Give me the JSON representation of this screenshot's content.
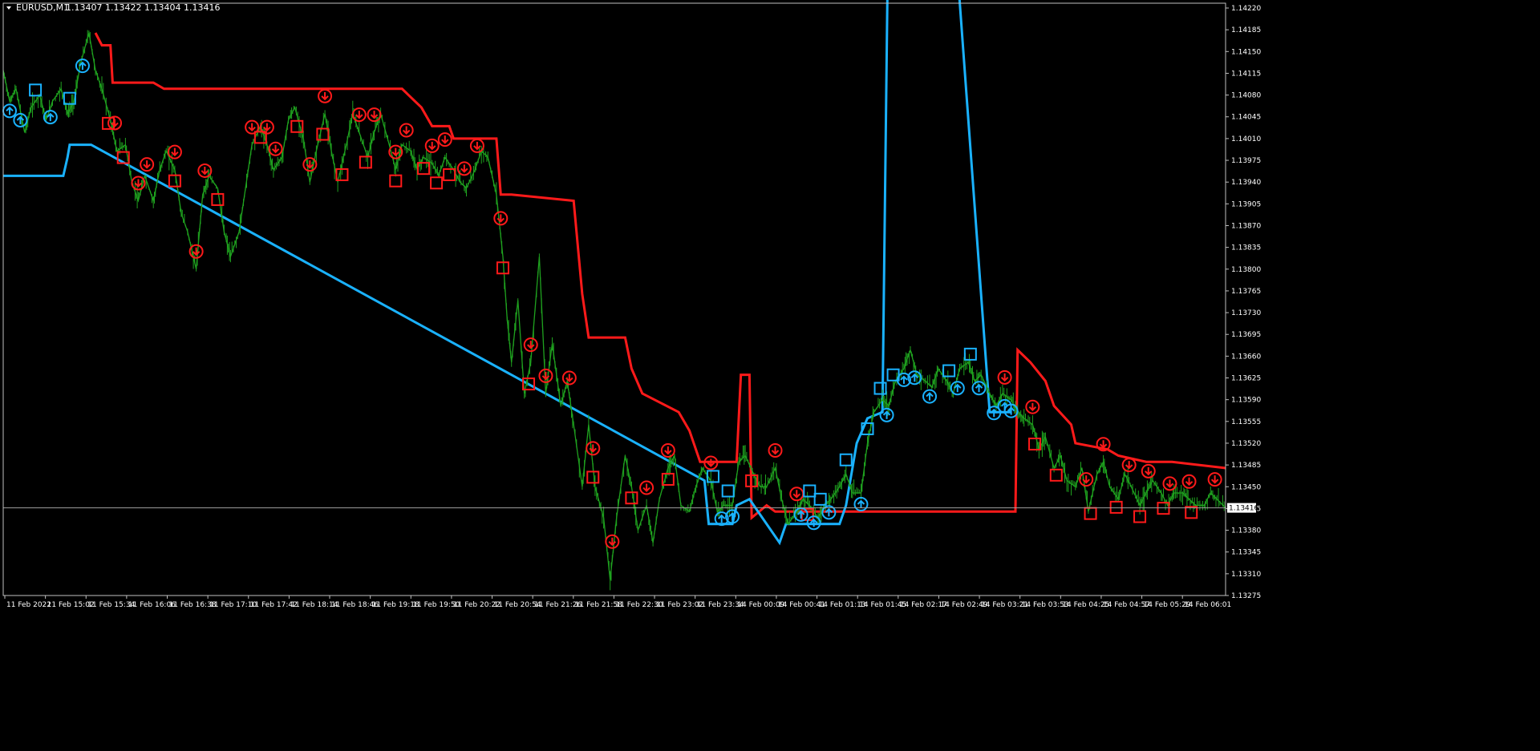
{
  "header": {
    "symbol": "EURUSD,M1",
    "quotes": "1.13407 1.13422 1.13404 1.13416"
  },
  "colors": {
    "background": "#000000",
    "frame": "#c0c0c0",
    "price": "#1fa21f",
    "upper_band": "#ff1a1a",
    "lower_band": "#1ab2ff",
    "sell_marker": "#ff1a1a",
    "buy_marker": "#1ab2ff",
    "current_price_line": "#9e9e9e",
    "price_tag_bg": "#ffffff"
  },
  "chart_data": {
    "type": "line",
    "ylim": [
      1.13275,
      1.1422
    ],
    "y_ticks": [
      "1.14220",
      "1.14185",
      "1.14150",
      "1.14115",
      "1.14080",
      "1.14045",
      "1.14010",
      "1.13975",
      "1.13940",
      "1.13905",
      "1.13870",
      "1.13835",
      "1.13800",
      "1.13765",
      "1.13730",
      "1.13695",
      "1.13660",
      "1.13625",
      "1.13590",
      "1.13555",
      "1.13520",
      "1.13485",
      "1.13450",
      "1.13415",
      "1.13380",
      "1.13345",
      "1.13310",
      "1.13275"
    ],
    "x_ticks": [
      "11 Feb 2022",
      "11 Feb 15:02",
      "11 Feb 15:34",
      "11 Feb 16:06",
      "11 Feb 16:38",
      "11 Feb 17:10",
      "11 Feb 17:42",
      "11 Feb 18:14",
      "11 Feb 18:46",
      "11 Feb 19:18",
      "11 Feb 19:50",
      "11 Feb 20:22",
      "11 Feb 20:54",
      "11 Feb 21:26",
      "11 Feb 21:58",
      "11 Feb 22:30",
      "11 Feb 23:02",
      "11 Feb 23:34",
      "14 Feb 00:09",
      "14 Feb 00:41",
      "14 Feb 01:13",
      "14 Feb 01:45",
      "14 Feb 02:17",
      "14 Feb 02:49",
      "14 Feb 03:21",
      "14 Feb 03:53",
      "14 Feb 04:25",
      "14 Feb 04:57",
      "14 Feb 05:29",
      "14 Feb 06:01"
    ],
    "current_price": 1.13416,
    "current_price_label": "1.13416",
    "series": [
      {
        "kind": "price",
        "points": [
          [
            0,
            1.1412
          ],
          [
            0.3,
            1.1407
          ],
          [
            0.6,
            1.1409
          ],
          [
            1,
            1.1402
          ],
          [
            1.3,
            1.1406
          ],
          [
            1.7,
            1.1408
          ],
          [
            2,
            1.1404
          ],
          [
            2.3,
            1.1407
          ],
          [
            2.7,
            1.1409
          ],
          [
            3,
            1.1405
          ],
          [
            3.3,
            1.1407
          ],
          [
            3.6,
            1.1413
          ],
          [
            4,
            1.1418
          ],
          [
            4.3,
            1.1412
          ],
          [
            4.6,
            1.1409
          ],
          [
            5,
            1.1404
          ],
          [
            5.3,
            1.1399
          ],
          [
            5.7,
            1.14
          ],
          [
            6,
            1.1394
          ],
          [
            6.3,
            1.1391
          ],
          [
            6.6,
            1.1395
          ],
          [
            7,
            1.1391
          ],
          [
            7.3,
            1.1396
          ],
          [
            7.6,
            1.1399
          ],
          [
            8,
            1.1396
          ],
          [
            8.3,
            1.1389
          ],
          [
            8.6,
            1.1386
          ],
          [
            9,
            1.138
          ],
          [
            9.3,
            1.1392
          ],
          [
            9.6,
            1.1395
          ],
          [
            10,
            1.1393
          ],
          [
            10.3,
            1.1386
          ],
          [
            10.6,
            1.1382
          ],
          [
            11,
            1.1386
          ],
          [
            11.3,
            1.1393
          ],
          [
            11.6,
            1.14
          ],
          [
            12,
            1.1403
          ],
          [
            12.3,
            1.14
          ],
          [
            12.6,
            1.1396
          ],
          [
            13,
            1.1398
          ],
          [
            13.3,
            1.1404
          ],
          [
            13.6,
            1.1406
          ],
          [
            14,
            1.1401
          ],
          [
            14.3,
            1.1394
          ],
          [
            14.6,
            1.1399
          ],
          [
            15,
            1.1405
          ],
          [
            15.3,
            1.1399
          ],
          [
            15.6,
            1.1394
          ],
          [
            16,
            1.14
          ],
          [
            16.3,
            1.1405
          ],
          [
            16.6,
            1.1402
          ],
          [
            17,
            1.1398
          ],
          [
            17.3,
            1.1402
          ],
          [
            17.6,
            1.1405
          ],
          [
            18,
            1.14
          ],
          [
            18.3,
            1.1396
          ],
          [
            18.6,
            1.14
          ],
          [
            19,
            1.1399
          ],
          [
            19.3,
            1.1396
          ],
          [
            19.6,
            1.1398
          ],
          [
            20,
            1.1397
          ],
          [
            20.3,
            1.1395
          ],
          [
            20.6,
            1.1398
          ],
          [
            21,
            1.1396
          ],
          [
            21.3,
            1.1394
          ],
          [
            21.6,
            1.1393
          ],
          [
            22,
            1.1396
          ],
          [
            22.3,
            1.1399
          ],
          [
            22.6,
            1.1398
          ],
          [
            23,
            1.1392
          ],
          [
            23.3,
            1.1382
          ],
          [
            23.5,
            1.1372
          ],
          [
            23.7,
            1.1365
          ],
          [
            24,
            1.1375
          ],
          [
            24.3,
            1.136
          ],
          [
            24.6,
            1.1365
          ],
          [
            25,
            1.1382
          ],
          [
            25.3,
            1.136
          ],
          [
            25.6,
            1.1368
          ],
          [
            26,
            1.1358
          ],
          [
            26.3,
            1.1362
          ],
          [
            26.6,
            1.1355
          ],
          [
            27,
            1.1345
          ],
          [
            27.3,
            1.1355
          ],
          [
            27.6,
            1.1345
          ],
          [
            28,
            1.134
          ],
          [
            28.3,
            1.133
          ],
          [
            28.6,
            1.134
          ],
          [
            29,
            1.135
          ],
          [
            29.3,
            1.1345
          ],
          [
            29.6,
            1.1338
          ],
          [
            30,
            1.1342
          ],
          [
            30.3,
            1.1336
          ],
          [
            30.6,
            1.1343
          ],
          [
            31,
            1.1348
          ],
          [
            31.3,
            1.135
          ],
          [
            31.6,
            1.1342
          ],
          [
            32,
            1.1341
          ],
          [
            32.3,
            1.1345
          ],
          [
            32.6,
            1.1348
          ],
          [
            33,
            1.1346
          ],
          [
            33.3,
            1.1341
          ],
          [
            33.6,
            1.1342
          ],
          [
            34,
            1.1342
          ],
          [
            34.3,
            1.1349
          ],
          [
            34.6,
            1.135
          ],
          [
            35,
            1.1347
          ],
          [
            35.3,
            1.1345
          ],
          [
            35.6,
            1.1345
          ],
          [
            36,
            1.1348
          ],
          [
            36.3,
            1.1343
          ],
          [
            36.6,
            1.1339
          ],
          [
            37,
            1.1341
          ],
          [
            37.3,
            1.1343
          ],
          [
            37.6,
            1.1342
          ],
          [
            38,
            1.134
          ],
          [
            38.3,
            1.1342
          ],
          [
            38.6,
            1.1343
          ],
          [
            39,
            1.1345
          ],
          [
            39.3,
            1.1347
          ],
          [
            39.6,
            1.1344
          ],
          [
            40,
            1.1344
          ],
          [
            40.3,
            1.1352
          ],
          [
            40.6,
            1.1357
          ],
          [
            41,
            1.1359
          ],
          [
            41.3,
            1.1358
          ],
          [
            41.6,
            1.1362
          ],
          [
            42,
            1.1364
          ],
          [
            42.3,
            1.1367
          ],
          [
            42.6,
            1.1363
          ],
          [
            43,
            1.1362
          ],
          [
            43.3,
            1.1361
          ],
          [
            43.6,
            1.1364
          ],
          [
            44,
            1.1362
          ],
          [
            44.3,
            1.136
          ],
          [
            44.6,
            1.1364
          ],
          [
            45,
            1.1365
          ],
          [
            45.3,
            1.1362
          ],
          [
            45.6,
            1.1363
          ],
          [
            46,
            1.136
          ],
          [
            46.3,
            1.1358
          ],
          [
            46.6,
            1.136
          ],
          [
            47,
            1.1359
          ],
          [
            47.3,
            1.1357
          ],
          [
            47.6,
            1.1356
          ],
          [
            48,
            1.1355
          ],
          [
            48.3,
            1.1351
          ],
          [
            48.6,
            1.1353
          ],
          [
            49,
            1.1348
          ],
          [
            49.3,
            1.135
          ],
          [
            49.6,
            1.1346
          ],
          [
            50,
            1.1345
          ],
          [
            50.3,
            1.1348
          ],
          [
            50.6,
            1.1341
          ],
          [
            51,
            1.1347
          ],
          [
            51.3,
            1.1349
          ],
          [
            51.6,
            1.1345
          ],
          [
            52,
            1.1343
          ],
          [
            52.3,
            1.1347
          ],
          [
            52.6,
            1.1345
          ],
          [
            53,
            1.1342
          ],
          [
            53.3,
            1.1344
          ],
          [
            53.6,
            1.1346
          ],
          [
            54,
            1.1344
          ],
          [
            54.3,
            1.1342
          ],
          [
            54.6,
            1.1344
          ],
          [
            55,
            1.1344
          ],
          [
            55.3,
            1.1343
          ],
          [
            55.6,
            1.1342
          ],
          [
            56,
            1.1342
          ],
          [
            56.3,
            1.1344
          ],
          [
            56.6,
            1.1343
          ],
          [
            57,
            1.13416
          ]
        ]
      },
      {
        "kind": "upper_band",
        "points": [
          [
            4.3,
            1.1418
          ],
          [
            4.6,
            1.1416
          ],
          [
            5,
            1.1416
          ],
          [
            5.1,
            1.141
          ],
          [
            7,
            1.141
          ],
          [
            7.5,
            1.1409
          ],
          [
            18.6,
            1.1409
          ],
          [
            19.5,
            1.1406
          ],
          [
            20,
            1.1403
          ],
          [
            20.8,
            1.1403
          ],
          [
            21,
            1.1401
          ],
          [
            23,
            1.1401
          ],
          [
            23.2,
            1.1392
          ],
          [
            23.7,
            1.1392
          ],
          [
            26.6,
            1.1391
          ],
          [
            27,
            1.1376
          ],
          [
            27.3,
            1.1369
          ],
          [
            29,
            1.1369
          ],
          [
            29.3,
            1.1364
          ],
          [
            29.8,
            1.136
          ],
          [
            31.5,
            1.1357
          ],
          [
            32,
            1.1354
          ],
          [
            32.5,
            1.1349
          ],
          [
            34.2,
            1.1349
          ],
          [
            34.4,
            1.1363
          ],
          [
            34.8,
            1.1363
          ],
          [
            34.9,
            1.134
          ],
          [
            35.6,
            1.1342
          ],
          [
            36,
            1.1341
          ],
          [
            37,
            1.1341
          ],
          [
            41,
            1.1341
          ],
          [
            46,
            1.1341
          ],
          [
            47.2,
            1.1341
          ],
          [
            47.3,
            1.1367
          ],
          [
            47.9,
            1.1365
          ],
          [
            48.6,
            1.1362
          ],
          [
            49,
            1.1358
          ],
          [
            49.8,
            1.1355
          ],
          [
            50,
            1.1352
          ],
          [
            51.5,
            1.1351
          ],
          [
            52,
            1.135
          ],
          [
            53.3,
            1.1349
          ],
          [
            54.5,
            1.1349
          ],
          [
            57,
            1.1348
          ]
        ]
      },
      {
        "kind": "lower_band",
        "points": [
          [
            0,
            1.1395
          ],
          [
            2.8,
            1.1395
          ],
          [
            3,
            1.1398
          ],
          [
            3.1,
            1.14
          ],
          [
            4.1,
            1.14
          ],
          [
            32.7,
            1.1346
          ],
          [
            32.9,
            1.1339
          ],
          [
            34,
            1.1339
          ],
          [
            34.2,
            1.1342
          ],
          [
            34.8,
            1.1343
          ],
          [
            36.2,
            1.1336
          ],
          [
            36.5,
            1.1339
          ],
          [
            39,
            1.1339
          ],
          [
            39.3,
            1.1342
          ],
          [
            39.8,
            1.1352
          ],
          [
            40.3,
            1.1356
          ],
          [
            41,
            1.1357
          ],
          [
            41.7,
            1.156
          ],
          [
            46,
            1.1357
          ],
          [
            47,
            1.1357
          ]
        ]
      }
    ]
  }
}
